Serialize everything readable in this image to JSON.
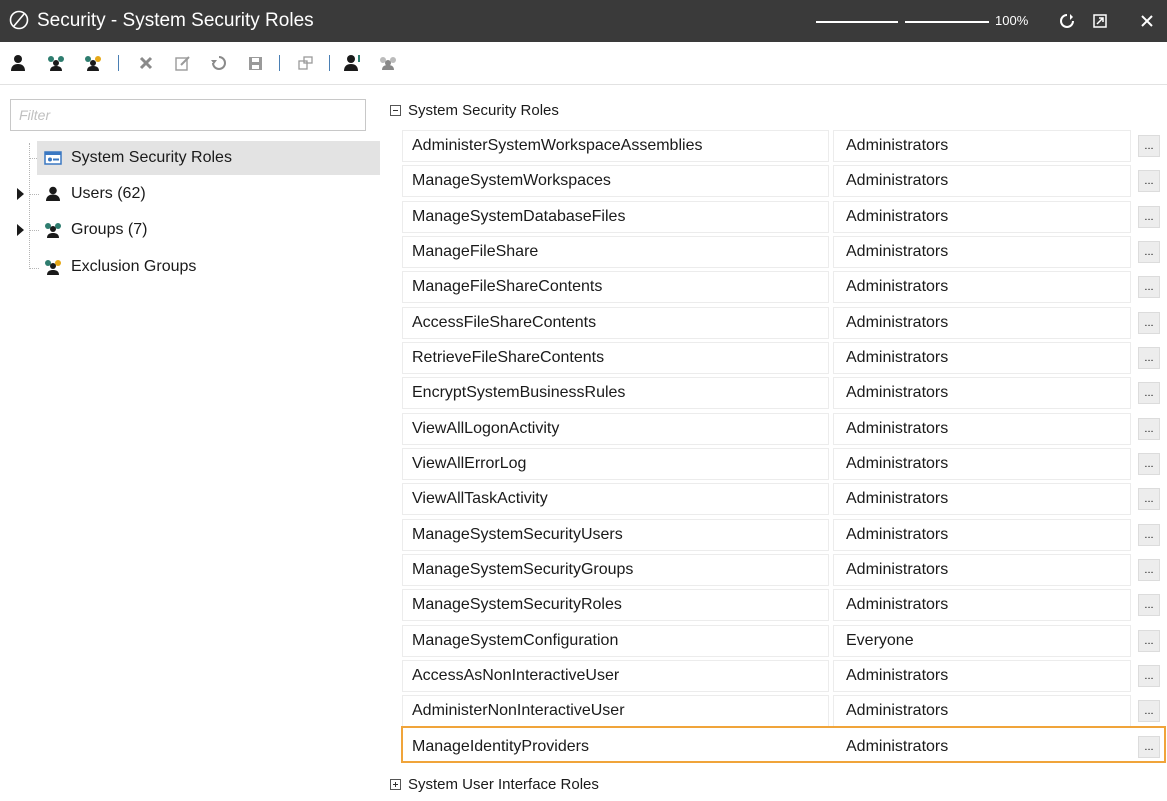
{
  "window": {
    "title": "Security - System Security Roles",
    "zoom": "100%",
    "zoom_level": 1.0
  },
  "toolbar": {
    "tools": [
      "user-icon",
      "group-icon",
      "exclusion-group-icon",
      "delete-icon",
      "edit-icon",
      "refresh-icon",
      "save-icon",
      "copy-icon",
      "user-role-icon",
      "group-role-icon"
    ]
  },
  "filter": {
    "placeholder": "Filter",
    "value": ""
  },
  "tree": {
    "root": "System Security Roles",
    "users": "Users (62)",
    "groups": "Groups (7)",
    "exclusion": "Exclusion Groups"
  },
  "roles": {
    "system_header": "System Security Roles",
    "ui_header": "System User Interface Roles",
    "more_label": "...",
    "items": [
      {
        "name": "AdministerSystemWorkspaceAssemblies",
        "group": "Administrators"
      },
      {
        "name": "ManageSystemWorkspaces",
        "group": "Administrators"
      },
      {
        "name": "ManageSystemDatabaseFiles",
        "group": "Administrators"
      },
      {
        "name": "ManageFileShare",
        "group": "Administrators"
      },
      {
        "name": "ManageFileShareContents",
        "group": "Administrators"
      },
      {
        "name": "AccessFileShareContents",
        "group": "Administrators"
      },
      {
        "name": "RetrieveFileShareContents",
        "group": "Administrators"
      },
      {
        "name": "EncryptSystemBusinessRules",
        "group": "Administrators"
      },
      {
        "name": "ViewAllLogonActivity",
        "group": "Administrators"
      },
      {
        "name": "ViewAllErrorLog",
        "group": "Administrators"
      },
      {
        "name": "ViewAllTaskActivity",
        "group": "Administrators"
      },
      {
        "name": "ManageSystemSecurityUsers",
        "group": "Administrators"
      },
      {
        "name": "ManageSystemSecurityGroups",
        "group": "Administrators"
      },
      {
        "name": "ManageSystemSecurityRoles",
        "group": "Administrators"
      },
      {
        "name": "ManageSystemConfiguration",
        "group": "Everyone"
      },
      {
        "name": "AccessAsNonInteractiveUser",
        "group": "Administrators"
      },
      {
        "name": "AdministerNonInteractiveUser",
        "group": "Administrators"
      },
      {
        "name": "ManageIdentityProviders",
        "group": "Administrators"
      }
    ]
  },
  "colors": {
    "titlebar": "#3a3a3a",
    "highlight": "#f0a43a",
    "selected": "#e3e3e3"
  }
}
